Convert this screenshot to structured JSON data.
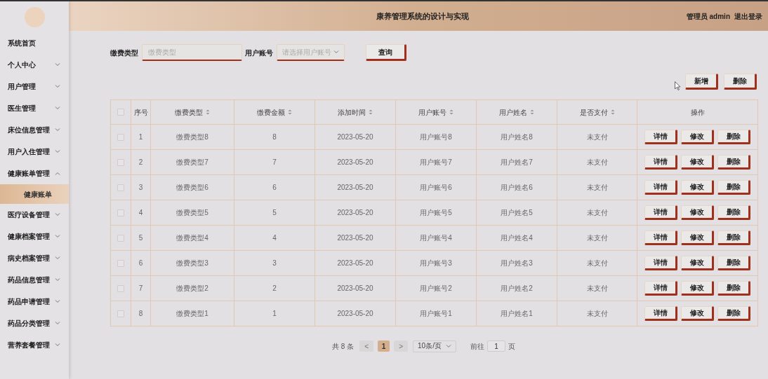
{
  "header": {
    "title": "康养管理系统的设计与实现",
    "user": "管理员 admin",
    "logout": "退出登录"
  },
  "sidebar": {
    "items": [
      {
        "kind": "link",
        "label": "系统首页"
      },
      {
        "kind": "menu",
        "label": "个人中心",
        "expanded": false
      },
      {
        "kind": "menu",
        "label": "用户管理",
        "expanded": false
      },
      {
        "kind": "menu",
        "label": "医生管理",
        "expanded": false
      },
      {
        "kind": "menu",
        "label": "床位信息管理",
        "expanded": false
      },
      {
        "kind": "menu",
        "label": "用户入住管理",
        "expanded": false
      },
      {
        "kind": "menu",
        "label": "健康账单管理",
        "expanded": true,
        "children": [
          {
            "label": "健康账单",
            "selected": true
          }
        ]
      },
      {
        "kind": "menu",
        "label": "医疗设备管理",
        "expanded": false
      },
      {
        "kind": "menu",
        "label": "健康档案管理",
        "expanded": false
      },
      {
        "kind": "menu",
        "label": "病史档案管理",
        "expanded": false
      },
      {
        "kind": "menu",
        "label": "药品信息管理",
        "expanded": false
      },
      {
        "kind": "menu",
        "label": "药品申请管理",
        "expanded": false
      },
      {
        "kind": "menu",
        "label": "药品分类管理",
        "expanded": false
      },
      {
        "kind": "menu",
        "label": "营养套餐管理",
        "expanded": false
      }
    ]
  },
  "search": {
    "fields": [
      {
        "kind": "input",
        "label": "缴费类型",
        "placeholder": "缴费类型"
      },
      {
        "kind": "select",
        "label": "用户账号",
        "placeholder": "请选择用户账号"
      }
    ],
    "button": "查询"
  },
  "toolbar": {
    "buttons": [
      "新增",
      "删除"
    ]
  },
  "table": {
    "columns": [
      {
        "label": "序号",
        "sortable": false
      },
      {
        "label": "缴费类型",
        "sortable": true
      },
      {
        "label": "缴费金额",
        "sortable": true
      },
      {
        "label": "添加时间",
        "sortable": true
      },
      {
        "label": "用户账号",
        "sortable": true
      },
      {
        "label": "用户姓名",
        "sortable": true
      },
      {
        "label": "是否支付",
        "sortable": true
      },
      {
        "label": "操作",
        "sortable": false
      }
    ],
    "header_checked": false,
    "rows": [
      {
        "checked": false,
        "cells": [
          "1",
          "缴费类型8",
          "8",
          "2023-05-20",
          "用户账号8",
          "用户姓名8",
          "未支付"
        ],
        "actions": [
          "详情",
          "修改",
          "删除"
        ]
      },
      {
        "checked": false,
        "cells": [
          "2",
          "缴费类型7",
          "7",
          "2023-05-20",
          "用户账号7",
          "用户姓名7",
          "未支付"
        ],
        "actions": [
          "详情",
          "修改",
          "删除"
        ]
      },
      {
        "checked": false,
        "cells": [
          "3",
          "缴费类型6",
          "6",
          "2023-05-20",
          "用户账号6",
          "用户姓名6",
          "未支付"
        ],
        "actions": [
          "详情",
          "修改",
          "删除"
        ]
      },
      {
        "checked": false,
        "cells": [
          "4",
          "缴费类型5",
          "5",
          "2023-05-20",
          "用户账号5",
          "用户姓名5",
          "未支付"
        ],
        "actions": [
          "详情",
          "修改",
          "删除"
        ]
      },
      {
        "checked": false,
        "cells": [
          "5",
          "缴费类型4",
          "4",
          "2023-05-20",
          "用户账号4",
          "用户姓名4",
          "未支付"
        ],
        "actions": [
          "详情",
          "修改",
          "删除"
        ]
      },
      {
        "checked": false,
        "cells": [
          "6",
          "缴费类型3",
          "3",
          "2023-05-20",
          "用户账号3",
          "用户姓名3",
          "未支付"
        ],
        "actions": [
          "详情",
          "修改",
          "删除"
        ]
      },
      {
        "checked": false,
        "cells": [
          "7",
          "缴费类型2",
          "2",
          "2023-05-20",
          "用户账号2",
          "用户姓名2",
          "未支付"
        ],
        "actions": [
          "详情",
          "修改",
          "删除"
        ]
      },
      {
        "checked": false,
        "cells": [
          "8",
          "缴费类型1",
          "1",
          "2023-05-20",
          "用户账号1",
          "用户姓名1",
          "未支付"
        ],
        "actions": [
          "详情",
          "修改",
          "删除"
        ]
      }
    ]
  },
  "pagination": {
    "total": "共 8 条",
    "prev": {
      "label": "<",
      "disabled": true
    },
    "pages": [
      {
        "label": "1",
        "selected": true
      }
    ],
    "next": {
      "label": ">",
      "disabled": true
    },
    "page_size": "10条/页",
    "goto_label": "前往",
    "goto_value": "1",
    "goto_suffix": "页"
  }
}
